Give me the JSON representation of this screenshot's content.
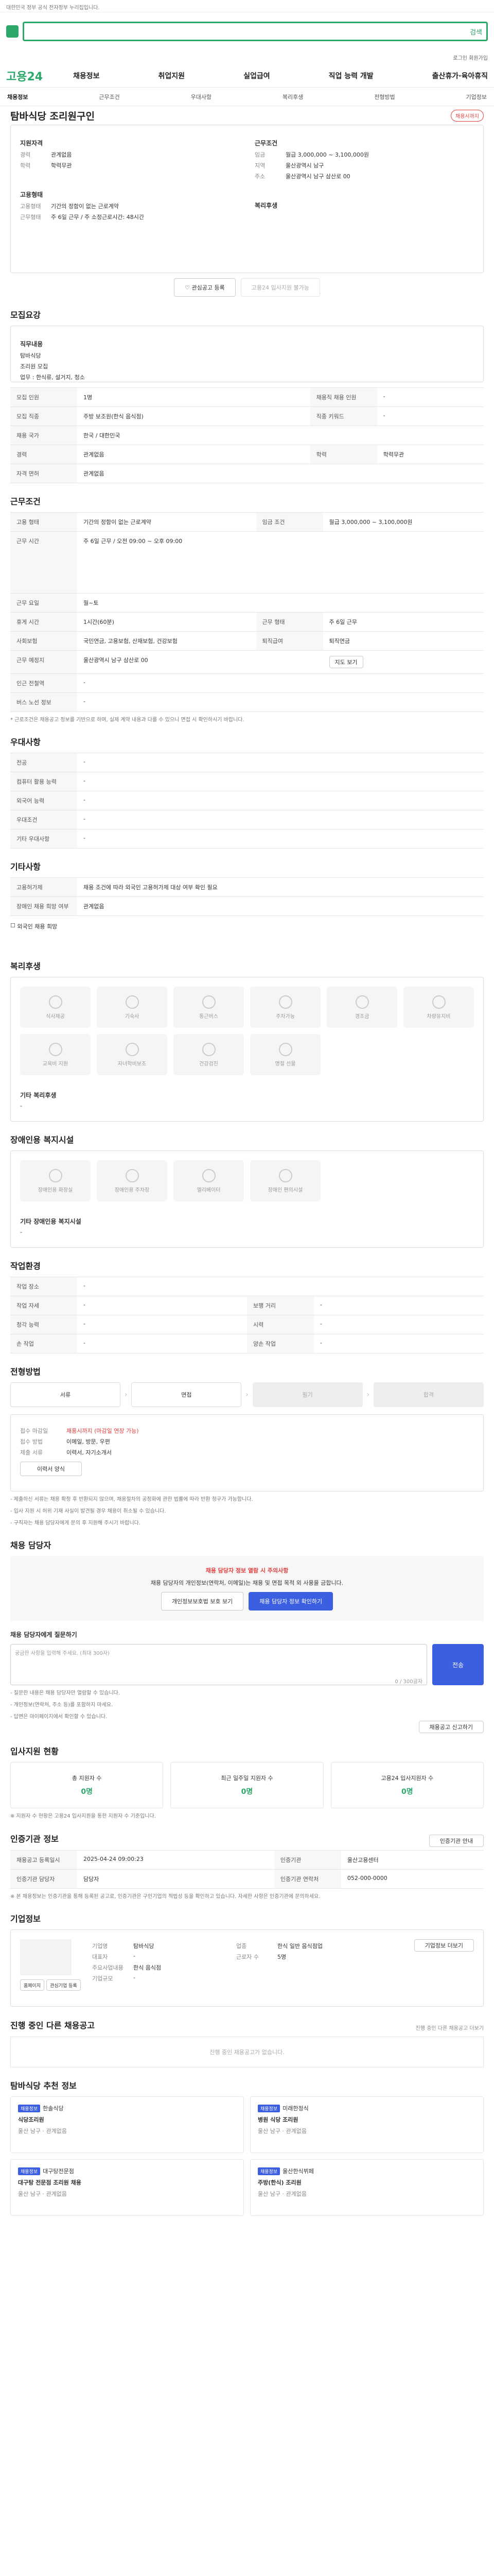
{
  "topbar": {
    "notice": "대한민국 정부 공식 전자정부 누리집입니다."
  },
  "search": {
    "button": "검색"
  },
  "util": {
    "links": "로그인 회원가입"
  },
  "gnb": {
    "brand": "고용24",
    "menu": [
      "채용정보",
      "취업지원",
      "실업급여",
      "직업 능력 개발",
      "출산휴가·육아휴직"
    ]
  },
  "lnb": {
    "items": [
      "채용정보",
      "근무조건",
      "우대사항",
      "복리후생",
      "전형방법",
      "기업정보"
    ]
  },
  "job": {
    "title": "탐바식당 조리원구인",
    "badge": "채용시까지",
    "company_label": "지원자격",
    "rows_left": [
      {
        "k": "경력",
        "v": "관계없음"
      },
      {
        "k": "학력",
        "v": "학력무관"
      }
    ],
    "rows_right_title": "근무조건",
    "rows_right": [
      {
        "k": "임금",
        "v": "월급 3,000,000 ~ 3,100,000원"
      },
      {
        "k": "지역",
        "v": "울산광역시 남구"
      },
      {
        "k": "주소",
        "v": "울산광역시 남구 삼산로 00"
      }
    ],
    "type_label": "고용형태",
    "type_rows": [
      {
        "k": "고용형태",
        "v": "기간의 정함이 없는 근로계약"
      },
      {
        "k": "근무형태",
        "v": "주 6일 근무 / 주 소정근로시간: 48시간"
      }
    ],
    "welfare_label": "복리후생",
    "btn_save": "관심공고 등록",
    "btn_apply": "고용24 입사지원 불가능"
  },
  "sec_summary": {
    "title": "모집요강",
    "job_title_label": "직무내용",
    "job_desc": "탐바식당",
    "job_desc2": "조리원 모집",
    "job_extra": "업무 : 한식류, 설거지, 청소",
    "rows": [
      {
        "k": "모집 인원",
        "v": "1명",
        "k2": "채용직 채용 인원",
        "v2": "-"
      },
      {
        "k": "모집 직종",
        "v": "주방 보조원(한식 음식점)",
        "k2": "직종 키워드",
        "v2": "-"
      },
      {
        "k": "채용 국가",
        "v": "한국 / 대한민국",
        "k2": "",
        "v2": ""
      },
      {
        "k": "경력",
        "v": "관계없음",
        "k2": "학력",
        "v2": "학력무관"
      },
      {
        "k": "자격 면허",
        "v": "관계없음",
        "k2": "",
        "v2": ""
      }
    ]
  },
  "sec_cond": {
    "title": "근무조건",
    "rows": [
      {
        "k": "고용 형태",
        "v": "기간의 정함이 없는 근로계약",
        "k2": "임금 조건",
        "v2": "월급 3,000,000 ~ 3,100,000원"
      },
      {
        "k": "근무 시간",
        "v": "주 6일 근무 / 오전 09:00 ~ 오후 09:00",
        "k2": "",
        "v2": ""
      },
      {
        "k": "근무 요일",
        "v": "월~토",
        "k2": "",
        "v2": ""
      },
      {
        "k": "휴게 시간",
        "v": "1시간(60분)",
        "k2": "근무 형태",
        "v2": "주 6일 근무"
      },
      {
        "k": "사회보험",
        "v": "국민연금, 고용보험, 산재보험, 건강보험",
        "k2": "퇴직급여",
        "v2": "퇴직연금"
      },
      {
        "k": "근무 예정지",
        "v": "울산광역시 남구 삼산로 00",
        "k2": "",
        "v2": ""
      },
      {
        "k": "인근 전철역",
        "v": "-",
        "k2": "",
        "v2": ""
      },
      {
        "k": "버스 노선 정보",
        "v": "-",
        "k2": "",
        "v2": ""
      }
    ],
    "map_btn": "지도 보기",
    "note": "* 근로조건은 채용공고 정보를 기반으로 하며, 실제 계약 내용과 다를 수 있으니 면접 시 확인하시기 바랍니다."
  },
  "sec_pref": {
    "title": "우대사항",
    "rows": [
      {
        "k": "전공",
        "v": "-"
      },
      {
        "k": "컴퓨터 활용 능력",
        "v": "-"
      },
      {
        "k": "외국어 능력",
        "v": "-"
      },
      {
        "k": "우대조건",
        "v": "-"
      },
      {
        "k": "기타 우대사항",
        "v": "-"
      }
    ]
  },
  "sec_etc": {
    "title": "기타사항",
    "rows": [
      {
        "k": "고용허가제",
        "v": "채용 조건에 따라 외국인 고용허가제 대상 여부 확인 필요"
      },
      {
        "k": "장애인 채용 희망 여부",
        "v": "관계없음"
      }
    ],
    "check": "외국인 채용 희망"
  },
  "sec_welfare": {
    "title": "복리후생",
    "items": [
      "식사제공",
      "기숙사",
      "통근버스",
      "주차가능",
      "경조금",
      "차량유지비",
      "교육비 지원",
      "자녀학비보조",
      "건강검진",
      "명절 선물",
      "",
      ""
    ],
    "extra_title": "기타 복리후생",
    "extra_value": "-"
  },
  "sec_disab": {
    "title": "장애인용 복지시설",
    "items": [
      "장애인용 화장실",
      "장애인용 주차장",
      "엘리베이터",
      "장애인 편의시설"
    ],
    "extra_title": "기타 장애인용 복지시설",
    "extra_value": "-"
  },
  "sec_env": {
    "title": "작업환경",
    "rows": [
      {
        "k": "작업 장소",
        "v": "-",
        "k2": "",
        "v2": ""
      },
      {
        "k": "작업 자세",
        "v": "-",
        "k2": "보행 거리",
        "v2": "-"
      },
      {
        "k": "청각 능력",
        "v": "-",
        "k2": "시력",
        "v2": "-"
      },
      {
        "k": "손 작업",
        "v": "-",
        "k2": "양손 작업",
        "v2": "-"
      }
    ]
  },
  "sec_process": {
    "title": "전형방법",
    "steps": [
      "서류",
      "면접",
      "필기",
      "합격"
    ],
    "rows": [
      {
        "k": "접수 마감일",
        "v": "채용시까지 (마감일 연장 가능)",
        "k2": "접수 방법",
        "v2": "이메일, 방문, 우편"
      },
      {
        "k": "제출 서류",
        "v": "이력서, 자기소개서",
        "k2": "",
        "v2": ""
      }
    ],
    "apply_btn": "이력서 양식",
    "notes": [
      "- 제출하신 서류는 채용 확정 후 반환되지 않으며, 채용절차의 공정화에 관한 법률에 따라 반환 청구가 가능합니다.",
      "- 입사 지원 시 허위 기재 사실이 발견될 경우 채용이 취소될 수 있습니다.",
      "- 구직자는 채용 담당자에게 문의 후 지원해 주시기 바랍니다."
    ]
  },
  "sec_contact": {
    "title": "채용 담당자",
    "notice": "채용 담당자 정보 열람 시 주의사항",
    "desc": "채용 담당자의 개인정보(연락처, 이메일)는 채용 및 면접 목적 외 사용을 금합니다.",
    "btn1": "개인정보보호법 보호 보기",
    "btn2": "채용 담당자 정보 확인하기",
    "ask_title": "채용 담당자에게 질문하기",
    "ask_hint": "궁금한 사항을 입력해 주세요. (최대 300자)",
    "ask_count": "0 / 300글자",
    "ask_send": "전송",
    "ask_notes": [
      "- 질문한 내용은 채용 담당자만 열람할 수 있습니다.",
      "- 개인정보(연락처, 주소 등)를 포함하지 마세요.",
      "- 답변은 마이페이지에서 확인할 수 있습니다."
    ],
    "ask_more": "채용공고 신고하기"
  },
  "sec_stats": {
    "title": "입사지원 현황",
    "items": [
      {
        "label": "총 지원자 수",
        "value": "0명"
      },
      {
        "label": "최근 일주일 지원자 수",
        "value": "0명"
      },
      {
        "label": "고용24 입사지원자 수",
        "value": "0명"
      }
    ],
    "note": "※ 지원자 수 현황은 고용24 입사지원을 통한 지원자 수 기준입니다."
  },
  "sec_info": {
    "title": "인증기관 정보",
    "btn": "인증기관 안내",
    "rows": [
      {
        "k": "채용공고 등록일시",
        "v": "2025-04-24 09:00:23",
        "k2": "인증기관",
        "v2": "울산고용센터"
      },
      {
        "k": "인증기관 담당자",
        "v": "담당자",
        "k2": "인증기관 연락처",
        "v2": "052-000-0000"
      }
    ],
    "map_btn": "지도 보기",
    "note": "※ 본 채용정보는 인증기관을 통해 등록된 공고로, 인증기관은 구인기업의 적법성 등을 확인하고 있습니다. 자세한 사항은 인증기관에 문의하세요."
  },
  "sec_company": {
    "title": "기업정보",
    "rows": [
      {
        "k": "기업명",
        "v": "탐바식당",
        "k2": "업종",
        "v2": "한식 일반 음식점업"
      },
      {
        "k": "대표자",
        "v": "-",
        "k2": "근로자 수",
        "v2": "5명"
      },
      {
        "k": "주요사업내용",
        "v": "한식 음식점",
        "k2": "",
        "v2": ""
      },
      {
        "k": "기업규모",
        "v": "-",
        "k2": "",
        "v2": ""
      }
    ],
    "btn1": "홈페이지",
    "btn2": "관심기업 등록",
    "side_btn": "기업정보 더보기"
  },
  "sec_same": {
    "title": "진행 중인 다른 채용공고",
    "more": "진행 중인 다른 채용공고 더보기",
    "empty": "진행 중인 채용공고가 없습니다."
  },
  "sec_recommend": {
    "title": "탐바식당 추천 정보",
    "cards": [
      {
        "tag": "채용정보",
        "org": "한솔식당",
        "name": "식당조리원",
        "info": "울산 남구 · 관계없음"
      },
      {
        "tag": "채용정보",
        "org": "미래한정식",
        "name": "병원 식당 조리원",
        "info": "울산 남구 · 관계없음"
      },
      {
        "tag": "채용정보",
        "org": "대구탕전문점",
        "name": "대구탕 전문점 조리원 채용",
        "info": "울산 남구 · 관계없음"
      },
      {
        "tag": "채용정보",
        "org": "울산한식뷔페",
        "name": "주방(한식) 조리원",
        "info": "울산 남구 · 관계없음"
      }
    ]
  }
}
